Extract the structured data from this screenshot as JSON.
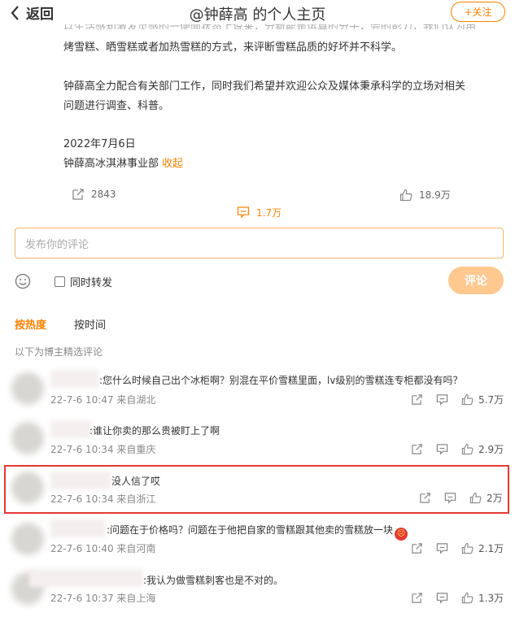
{
  "header": {
    "back_label": "返回",
    "title": "@钟薛高 的个人主页",
    "follow_label": "+关注"
  },
  "post": {
    "cut_line": "以生活感知激发灵感的一便面状态上说来，分新能是运算的分子，会的影力，我们认为用",
    "line1": "烤雪糕、晒雪糕或者加热雪糕的方式，来评断雪糕品质的好坏并不科学。",
    "para2_line1": "钟薛高全力配合有关部门工作，同时我们希望并欢迎公众及媒体秉承科学的立场对相关",
    "para2_line2": "问题进行调查、科普。",
    "date": "2022年7月6日",
    "dept": "钟薛高冰淇淋事业部",
    "collapse": "收起"
  },
  "actions": {
    "repost_count": "2843",
    "comment_count": "1.7万",
    "like_count": "18.9万"
  },
  "comment_box": {
    "placeholder": "发布你的评论",
    "repost_label": "同时转发",
    "submit_label": "评论"
  },
  "sort": {
    "hot_label": "按热度",
    "time_label": "按时间",
    "note": "以下为博主精选评论"
  },
  "comments": [
    {
      "text": ":您什么时候自己出个冰柜啊？别混在平价雪糕里面，lv级别的雪糕连专柜都没有吗？",
      "meta": "22-7-6 10:47 来自湖北",
      "likes": "5.7万"
    },
    {
      "text": ":谁让你卖的那么贵被盯上了啊",
      "meta": "22-7-6 10:34 来自重庆",
      "likes": "2.9万"
    },
    {
      "text": "没人信了哎",
      "meta": "22-7-6 10:34 来自浙江",
      "likes": "2万"
    },
    {
      "text": ":问题在于价格吗？问题在于他把自家的雪糕跟其他卖的雪糕放一块",
      "meta": "22-7-6 10:40 来自河南",
      "likes": "2.1万"
    },
    {
      "text": ":我认为做雪糕刺客也是不对的。",
      "meta": "22-7-6 10:37 来自上海",
      "likes": "1.3万"
    }
  ],
  "colors": {
    "accent": "#ff8200",
    "highlight": "#e53935"
  },
  "icons": [
    "chevron-left-icon",
    "repost-icon",
    "comment-icon",
    "like-icon",
    "emoji-icon"
  ]
}
